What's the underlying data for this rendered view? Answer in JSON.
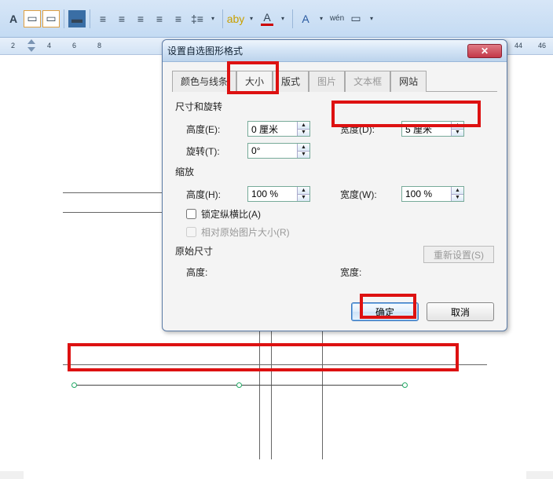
{
  "ribbon": {
    "text_a": "A",
    "fc_a": "A",
    "aby": "aby",
    "web_a": "A",
    "wen": "wén"
  },
  "ruler": {
    "numbers": [
      2,
      4,
      6,
      8,
      44,
      46
    ]
  },
  "dialog": {
    "title": "设置自选图形格式",
    "tabs": {
      "color_line": "颜色与线条",
      "size": "大小",
      "layout": "版式",
      "picture": "图片",
      "textbox": "文本框",
      "web": "网站"
    },
    "section_size_rotate": "尺寸和旋转",
    "section_scale": "缩放",
    "section_original": "原始尺寸",
    "labels": {
      "height_e": "高度(E):",
      "width_d": "宽度(D):",
      "rotate_t": "旋转(T):",
      "height_h": "高度(H):",
      "width_w": "宽度(W):",
      "height_plain": "高度:",
      "width_plain": "宽度:"
    },
    "values": {
      "height_e": "0 厘米",
      "width_d": "5 厘米",
      "rotate_t": "0°",
      "height_h": "100 %",
      "width_w": "100 %"
    },
    "checkboxes": {
      "lock_aspect": "锁定纵横比(A)",
      "relative_original": "相对原始图片大小(R)"
    },
    "buttons": {
      "reset": "重新设置(S)",
      "ok": "确定",
      "cancel": "取消"
    }
  }
}
